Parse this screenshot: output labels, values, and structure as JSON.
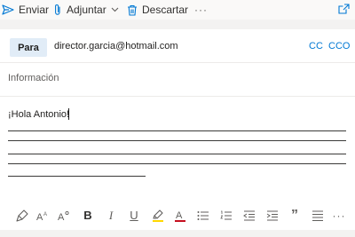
{
  "toolbar": {
    "send_label": "Enviar",
    "attach_label": "Adjuntar",
    "discard_label": "Descartar",
    "more_label": "···"
  },
  "recipients": {
    "to_button": "Para",
    "to_address": "director.garcia@hotmail.com",
    "cc_label": "CC",
    "cco_label": "CCO"
  },
  "subject": {
    "placeholder": "Información",
    "value": ""
  },
  "body": {
    "greeting": "¡Hola Antonio!"
  },
  "format": {
    "bold_label": "B",
    "italic_label": "I",
    "underline_label": "U",
    "font_color_label": "A",
    "quote_label": "”",
    "more_label": "···"
  },
  "colors": {
    "accent": "#0078d4",
    "to_button_bg": "#e1ecf7",
    "highlight": "#ffd700",
    "font_color_bar": "#c50f1f"
  }
}
